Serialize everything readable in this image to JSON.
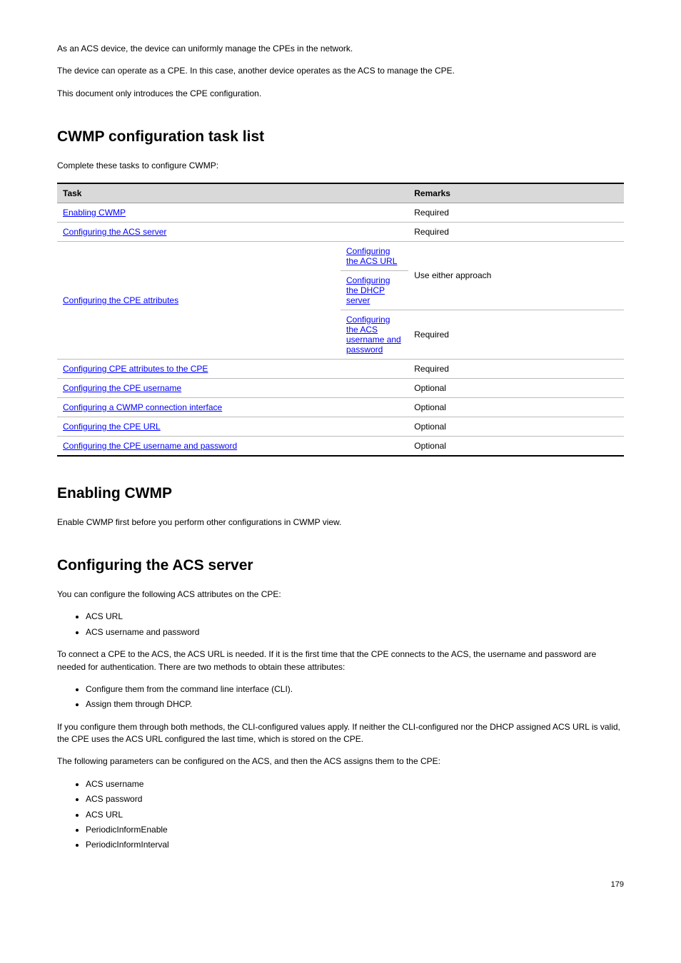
{
  "intro": {
    "p1": "As an ACS device, the device can uniformly manage the CPEs in the network.",
    "p2": "The device can operate as a CPE. In this case, another device operates as the ACS to manage the CPE.",
    "p3": "This document only introduces the CPE configuration."
  },
  "section_cfg_task_list": {
    "heading": "CWMP configuration task list",
    "intro": "Complete these tasks to configure CWMP:",
    "table": {
      "head": {
        "task": "Task",
        "remarks": "Remarks"
      },
      "rows": [
        {
          "task_link": "Enabling CWMP",
          "remark": "Required"
        },
        {
          "task_link": "Configuring the ACS server",
          "remark": "Required"
        },
        {
          "left_link": "Configuring the CPE attributes",
          "sub": [
            {
              "link": "Configuring the ACS URL",
              "remark_multi": "Use either approach"
            },
            {
              "link": "Configuring the DHCP server"
            },
            {
              "link": "Configuring the ACS username and password",
              "remark_multi": "Required"
            }
          ]
        },
        {
          "task_link": "Configuring CPE attributes to the CPE",
          "remark": "Required"
        },
        {
          "task_link": "Configuring the CPE username",
          "remark": "Optional"
        },
        {
          "task_link": "Configuring a CWMP connection interface",
          "remark": "Optional"
        },
        {
          "task_link": "Configuring the CPE URL",
          "remark": "Optional"
        },
        {
          "task_link": "Configuring the CPE username and password",
          "remark": "Optional"
        }
      ]
    }
  },
  "section_enabling": {
    "heading": "Enabling CWMP",
    "p": "Enable CWMP first before you perform other configurations in CWMP view."
  },
  "section_acs": {
    "heading": "Configuring the ACS server",
    "p1": "You can configure the following ACS attributes on the CPE:",
    "list1": [
      "ACS URL",
      "ACS username and password"
    ],
    "p2": "To connect a CPE to the ACS, the ACS URL is needed. If it is the first time that the CPE connects to the ACS, the username and password are needed for authentication. There are two methods to obtain these attributes:",
    "list2": [
      "Configure them from the command line interface (CLI).",
      "Assign them through DHCP."
    ],
    "p3": "If you configure them through both methods, the CLI-configured values apply. If neither the CLI-configured nor the DHCP assigned ACS URL is valid, the CPE uses the ACS URL configured the last time, which is stored on the CPE.",
    "p4": "The following parameters can be configured on the ACS, and then the ACS assigns them to the CPE:",
    "list3": [
      "ACS username",
      "ACS password",
      "ACS URL",
      "PeriodicInformEnable",
      "PeriodicInformInterval"
    ]
  },
  "page_num": "179"
}
